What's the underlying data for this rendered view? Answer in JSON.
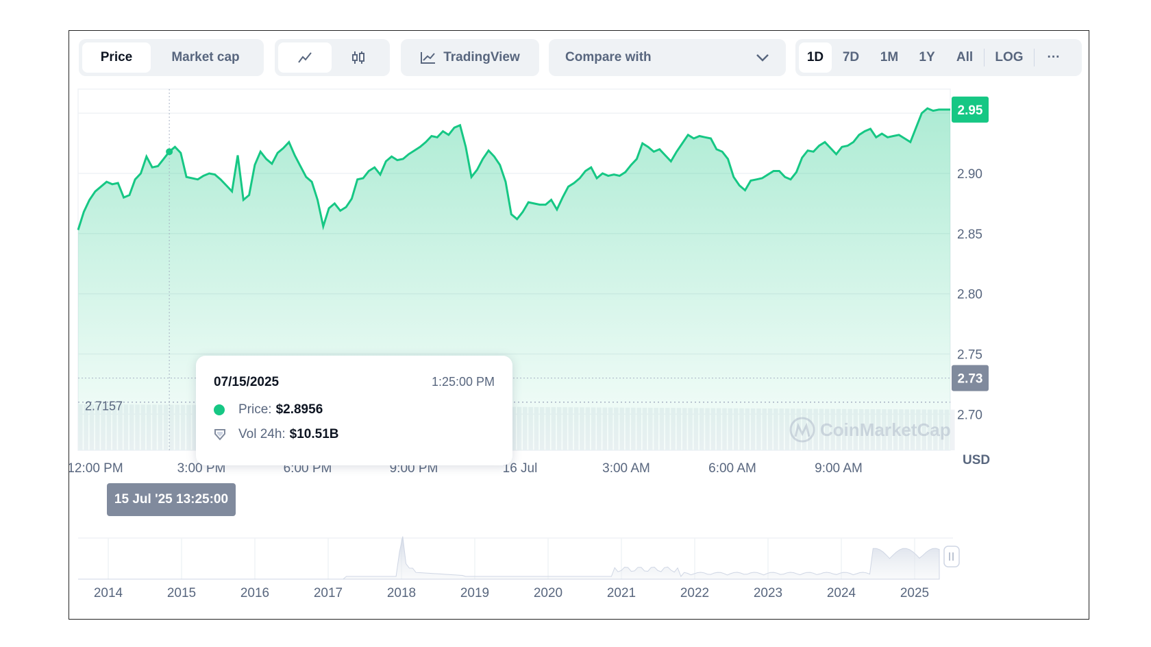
{
  "toolbar": {
    "tabs": [
      {
        "label": "Price",
        "active": true
      },
      {
        "label": "Market cap",
        "active": false
      }
    ],
    "chart_types": [
      {
        "icon": "line-chart-icon",
        "active": true
      },
      {
        "icon": "candlestick-icon",
        "active": false
      }
    ],
    "tradingview_label": "TradingView",
    "compare_label": "Compare with",
    "ranges": [
      "1D",
      "7D",
      "1M",
      "1Y",
      "All"
    ],
    "active_range": "1D",
    "log_label": "LOG",
    "more_label": "···"
  },
  "tooltip": {
    "date": "07/15/2025",
    "time": "1:25:00 PM",
    "price_label": "Price:",
    "price_value": "$2.8956",
    "vol_label": "Vol 24h:",
    "vol_value": "$10.51B"
  },
  "crosshair_label": "15 Jul '25 13:25:00",
  "open_price_label": "2.7157",
  "current_price_tag": "2.95",
  "hover_price_tag": "2.73",
  "watermark": "CoinMarketCap",
  "currency_label": "USD",
  "colors": {
    "up": "#16c784",
    "axis_tag": "#808a9d",
    "text_muted": "#58667e"
  },
  "chart_data": {
    "type": "area",
    "title": "",
    "xlabel": "",
    "ylabel": "",
    "ylim": [
      2.67,
      2.97
    ],
    "yticks": [
      "2.70",
      "2.75",
      "2.80",
      "2.85",
      "2.90",
      "2.95"
    ],
    "xticks": [
      "12:00 PM",
      "3:00 PM",
      "6:00 PM",
      "9:00 PM",
      "16 Jul",
      "3:00 AM",
      "6:00 AM",
      "9:00 AM"
    ],
    "series": [
      {
        "values": [
          2.853,
          2.868,
          2.878,
          2.885,
          2.889,
          2.893,
          2.891,
          2.892,
          2.88,
          2.882,
          2.895,
          2.9,
          2.914,
          2.905,
          2.906,
          2.912,
          2.918,
          2.922,
          2.917,
          2.897,
          2.896,
          2.895,
          2.898,
          2.9,
          2.899,
          2.895,
          2.89,
          2.885,
          2.915,
          2.878,
          2.882,
          2.907,
          2.918,
          2.912,
          2.908,
          2.917,
          2.921,
          2.926,
          2.915,
          2.906,
          2.897,
          2.893,
          2.878,
          2.856,
          2.871,
          2.875,
          2.869,
          2.872,
          2.879,
          2.895,
          2.896,
          2.902,
          2.905,
          2.899,
          2.91,
          2.914,
          2.911,
          2.912,
          2.916,
          2.919,
          2.922,
          2.926,
          2.931,
          2.93,
          2.935,
          2.932,
          2.938,
          2.94,
          2.922,
          2.897,
          2.903,
          2.912,
          2.919,
          2.914,
          2.907,
          2.893,
          2.866,
          2.862,
          2.868,
          2.876,
          2.875,
          2.874,
          2.874,
          2.878,
          2.87,
          2.88,
          2.889,
          2.892,
          2.896,
          2.902,
          2.905,
          2.896,
          2.9,
          2.898,
          2.899,
          2.898,
          2.901,
          2.907,
          2.912,
          2.925,
          2.922,
          2.918,
          2.92,
          2.915,
          2.91,
          2.918,
          2.925,
          2.932,
          2.929,
          2.931,
          2.93,
          2.929,
          2.92,
          2.918,
          2.912,
          2.897,
          2.89,
          2.886,
          2.894,
          2.895,
          2.896,
          2.899,
          2.902,
          2.902,
          2.897,
          2.895,
          2.901,
          2.913,
          2.919,
          2.918,
          2.923,
          2.926,
          2.921,
          2.916,
          2.922,
          2.923,
          2.926,
          2.932,
          2.935,
          2.937,
          2.93,
          2.933,
          2.93,
          2.931,
          2.932,
          2.929,
          2.926,
          2.938,
          2.95,
          2.954,
          2.952,
          2.953,
          2.953,
          2.953
        ]
      }
    ],
    "volume_start": "2.71",
    "overview": {
      "type": "area",
      "xticks": [
        "2014",
        "2015",
        "2016",
        "2017",
        "2018",
        "2019",
        "2020",
        "2021",
        "2022",
        "2023",
        "2024",
        "2025"
      ]
    },
    "grid": true,
    "legend": "none"
  }
}
